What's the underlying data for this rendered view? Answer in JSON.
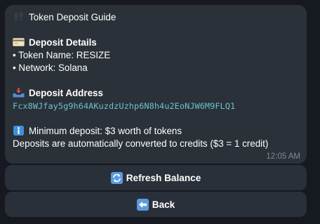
{
  "message": {
    "title_icon": "footprints-icon",
    "title": "Token Deposit Guide",
    "details_icon": "credit-card-icon",
    "details_heading": "Deposit Details",
    "token_line": "• Token Name: RESIZE",
    "network_line": "• Network: Solana",
    "address_icon": "inbox-tray-icon",
    "address_heading": "Deposit Address",
    "address_value": "Fcx8WJfay5g9h64AKuzdzUzhp6N8h4u2EoNJW6M9FLQ1",
    "info_icon": "info-icon",
    "minimum_line": "Minimum deposit: $3 worth of tokens",
    "conversion_line": "Deposits are automatically converted to credits ($3 = 1 credit)",
    "timestamp": "12:05 AM"
  },
  "buttons": {
    "refresh_label": "Refresh Balance",
    "refresh_icon": "refresh-icon",
    "back_label": "Back",
    "back_icon": "back-arrow-icon"
  },
  "colors": {
    "background": "#16191f",
    "bubble": "#2b3138",
    "button": "#2a3039",
    "address": "#6ac0cf",
    "timestamp": "#7d8a96",
    "emoji_blue": "#3f8fd8"
  }
}
